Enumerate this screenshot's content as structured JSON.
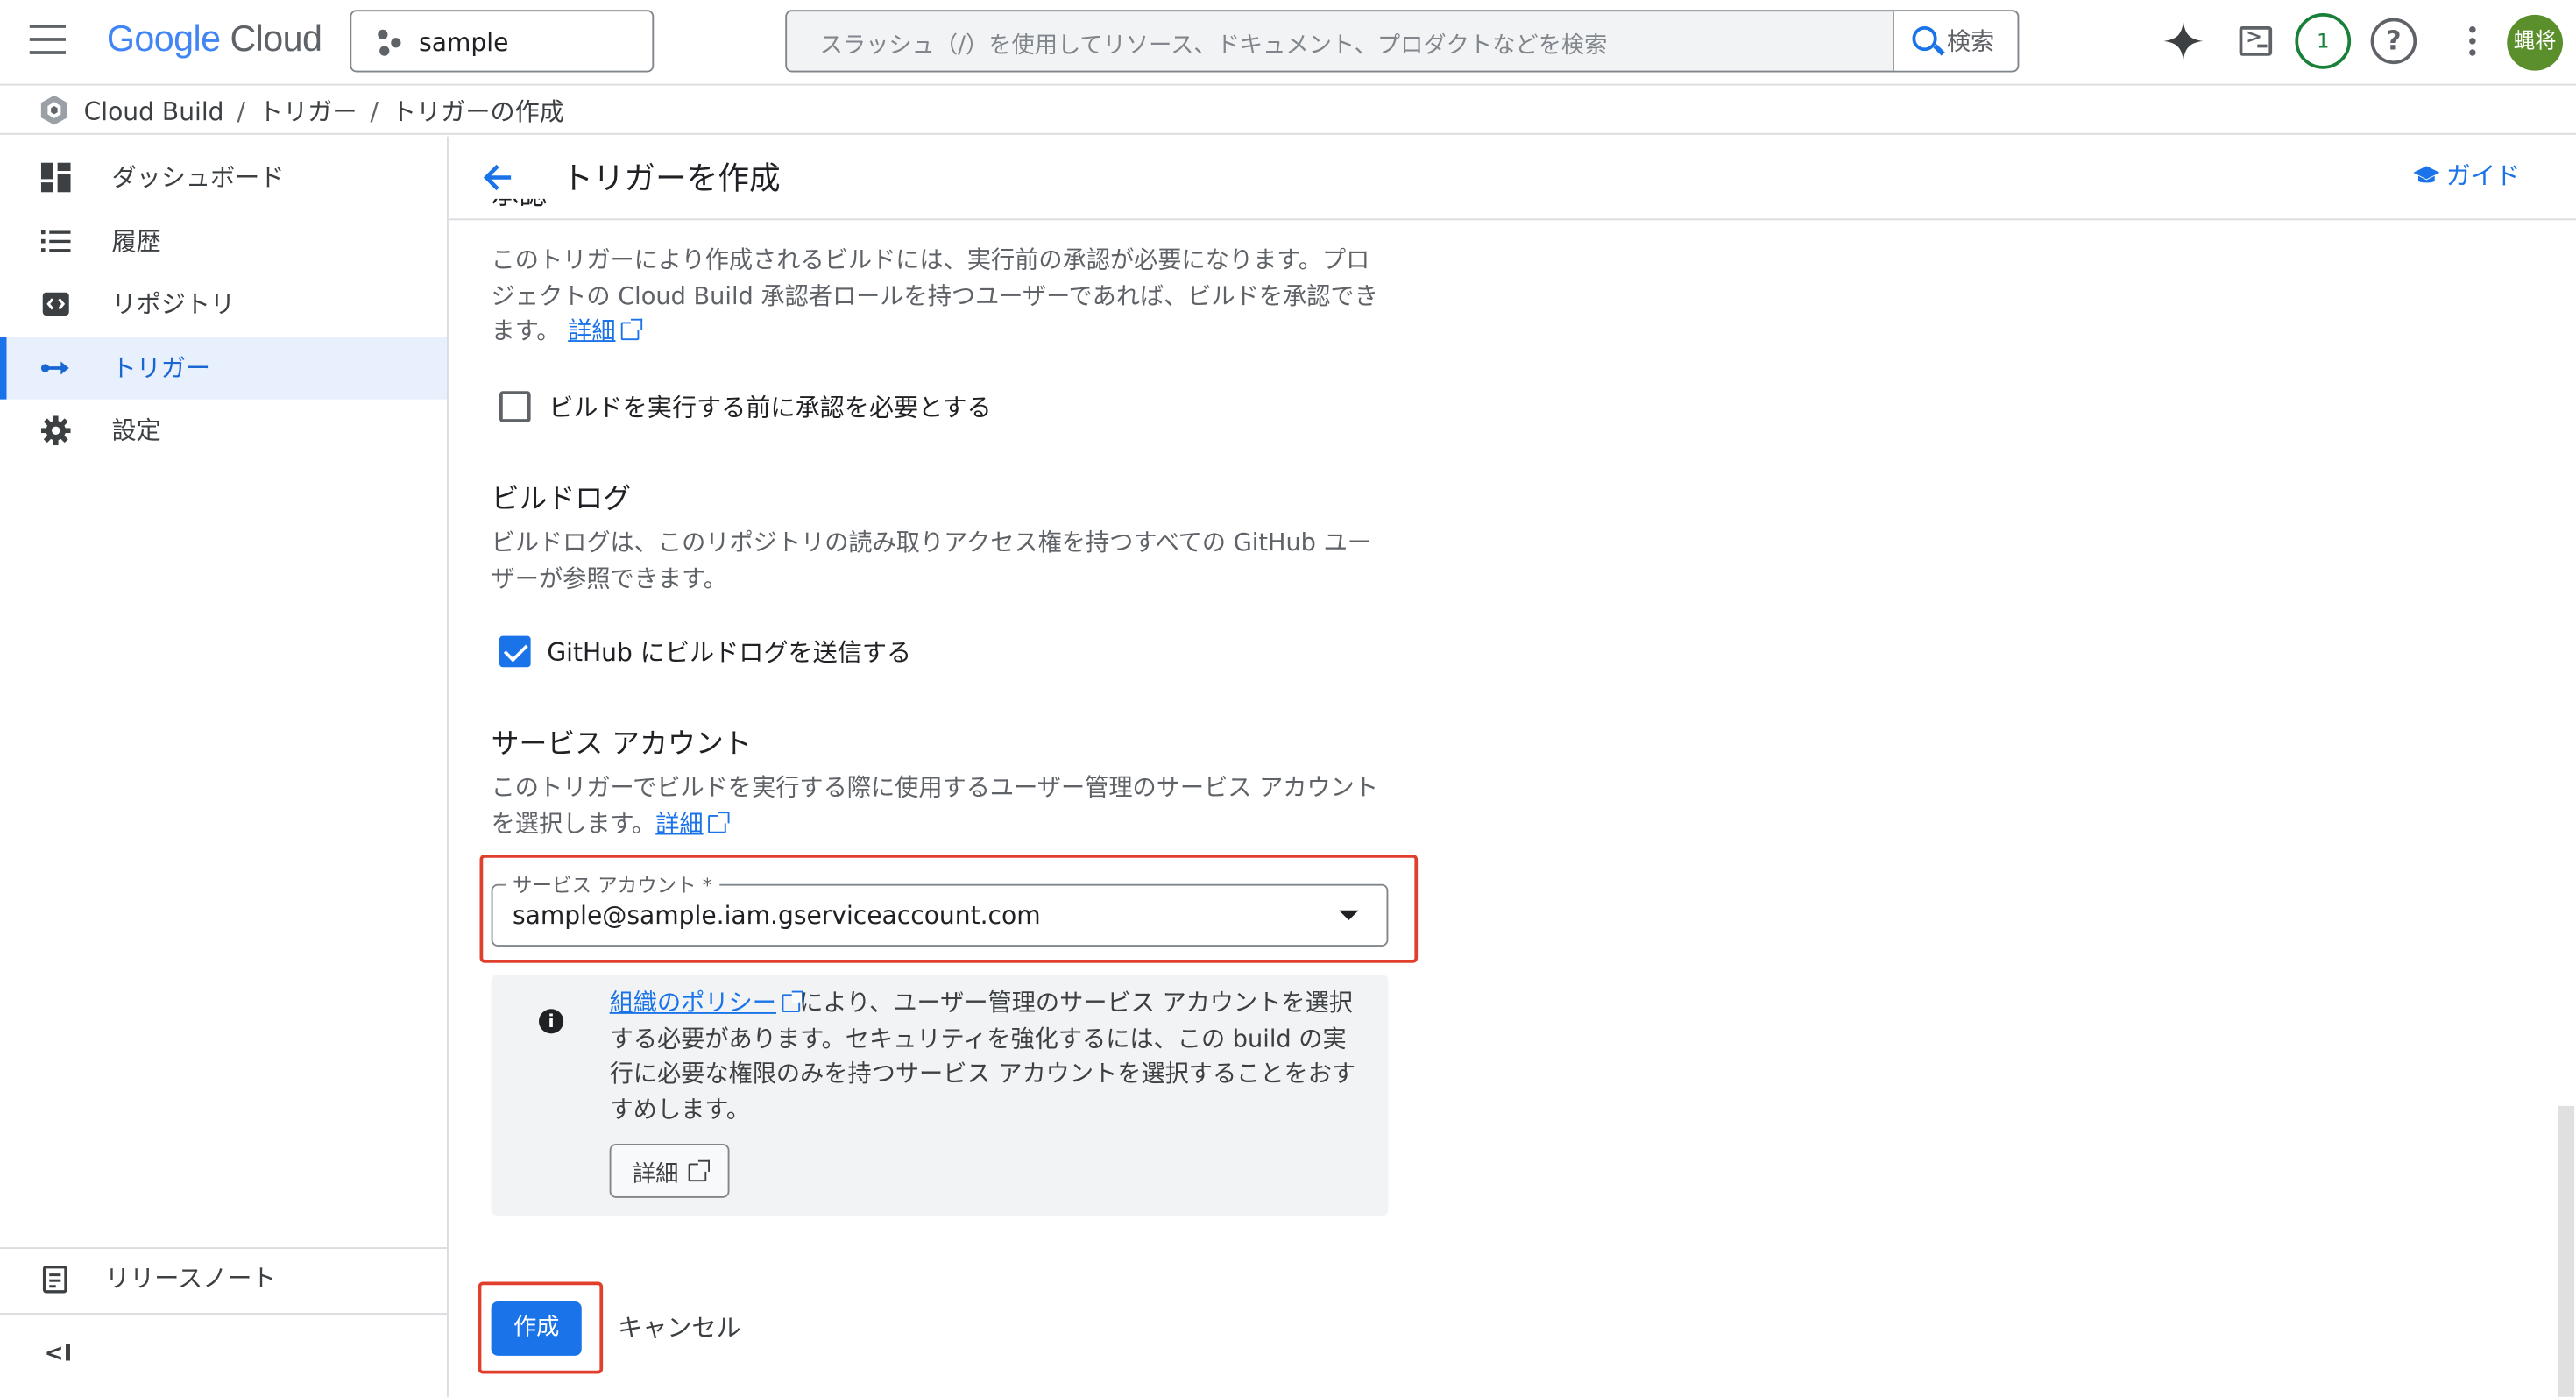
{
  "header": {
    "logo_google": "Google",
    "logo_cloud": "Cloud",
    "project": "sample",
    "search_placeholder": "スラッシュ（/）を使用してリソース、ドキュメント、プロダクトなどを検索",
    "search_button": "検索",
    "notification_count": "1",
    "help": "?",
    "avatar_text": "蝿将"
  },
  "breadcrumb": {
    "items": [
      "Cloud Build",
      "トリガー",
      "トリガーの作成"
    ],
    "separator": "/"
  },
  "sidebar": {
    "items": [
      {
        "label": "ダッシュボード",
        "icon": "dashboard-icon"
      },
      {
        "label": "履歴",
        "icon": "list-icon"
      },
      {
        "label": "リポジトリ",
        "icon": "repository-icon"
      },
      {
        "label": "トリガー",
        "icon": "trigger-icon",
        "active": true
      },
      {
        "label": "設定",
        "icon": "gear-icon"
      }
    ],
    "release_notes": "リリースノート",
    "collapse": "<I"
  },
  "main": {
    "title": "トリガーを作成",
    "guide": "ガイド",
    "approval": {
      "cut_heading": "承認",
      "description": "このトリガーにより作成されるビルドには、実行前の承認が必要になります。プロジェクトの Cloud Build 承認者ロールを持つユーザーであれば、ビルドを承認できます。",
      "link": "詳細",
      "checkbox_label": "ビルドを実行する前に承認を必要とする",
      "checked": false
    },
    "build_log": {
      "heading": "ビルドログ",
      "description": "ビルドログは、このリポジトリの読み取りアクセス権を持つすべての GitHub ユーザーが参照できます。",
      "checkbox_label": "GitHub にビルドログを送信する",
      "checked": true
    },
    "service_account": {
      "heading": "サービス アカウント",
      "description": "このトリガーでビルドを実行する際に使用するユーザー管理のサービス アカウントを選択します。",
      "link": "詳細",
      "field_label": "サービス アカウント *",
      "field_value": "sample@sample.iam.gserviceaccount.com"
    },
    "info": {
      "link": "組織のポリシー",
      "text": "により、ユーザー管理のサービス アカウントを選択する必要があります。セキュリティを強化するには、この build の実行に必要な権限のみを持つサービス アカウントを選択することをおすすめします。",
      "button": "詳細"
    },
    "actions": {
      "create": "作成",
      "cancel": "キャンセル"
    }
  },
  "colors": {
    "primary": "#1a73e8",
    "highlight": "#e0402b",
    "avatar": "#5a8f2b",
    "notification": "#188038"
  }
}
